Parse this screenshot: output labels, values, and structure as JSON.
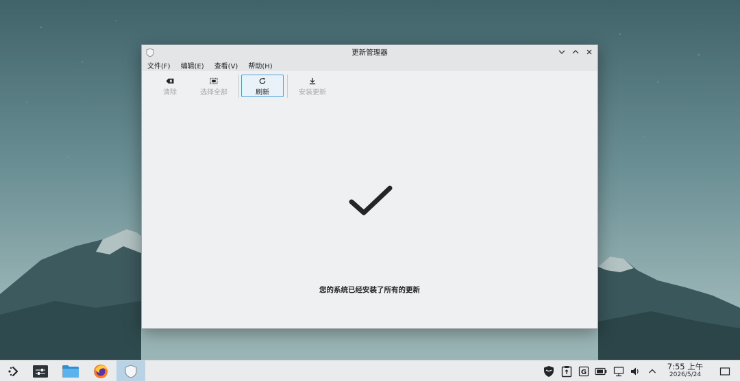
{
  "window": {
    "title": "更新管理器",
    "menu": [
      "文件(F)",
      "编辑(E)",
      "查看(V)",
      "帮助(H)"
    ],
    "toolbar": {
      "clear_label": "清除",
      "select_all_label": "选择全部",
      "refresh_label": "刷新",
      "install_label": "安装更新"
    },
    "status_message": "您的系统已经安装了所有的更新"
  },
  "taskbar": {
    "clock_time": "7:55 上午",
    "clock_date": "2026/5/24"
  },
  "colors": {
    "accent": "#4fa0d8",
    "window_bg": "#eff0f1",
    "text": "#232629",
    "disabled_text": "#a6a9ab"
  },
  "icons": [
    "shield-icon",
    "minimize-icon",
    "maximize-icon",
    "close-icon",
    "clear-icon",
    "select-all-icon",
    "refresh-icon",
    "download-icon",
    "checkmark-icon",
    "app-launcher-icon",
    "settings-panel-icon",
    "folder-icon",
    "firefox-icon",
    "shield-icon",
    "vpn-shield-icon",
    "clipboard-icon",
    "keyboard-layout-icon",
    "battery-icon",
    "network-icon",
    "volume-icon",
    "chevron-up-icon",
    "show-desktop-icon"
  ]
}
